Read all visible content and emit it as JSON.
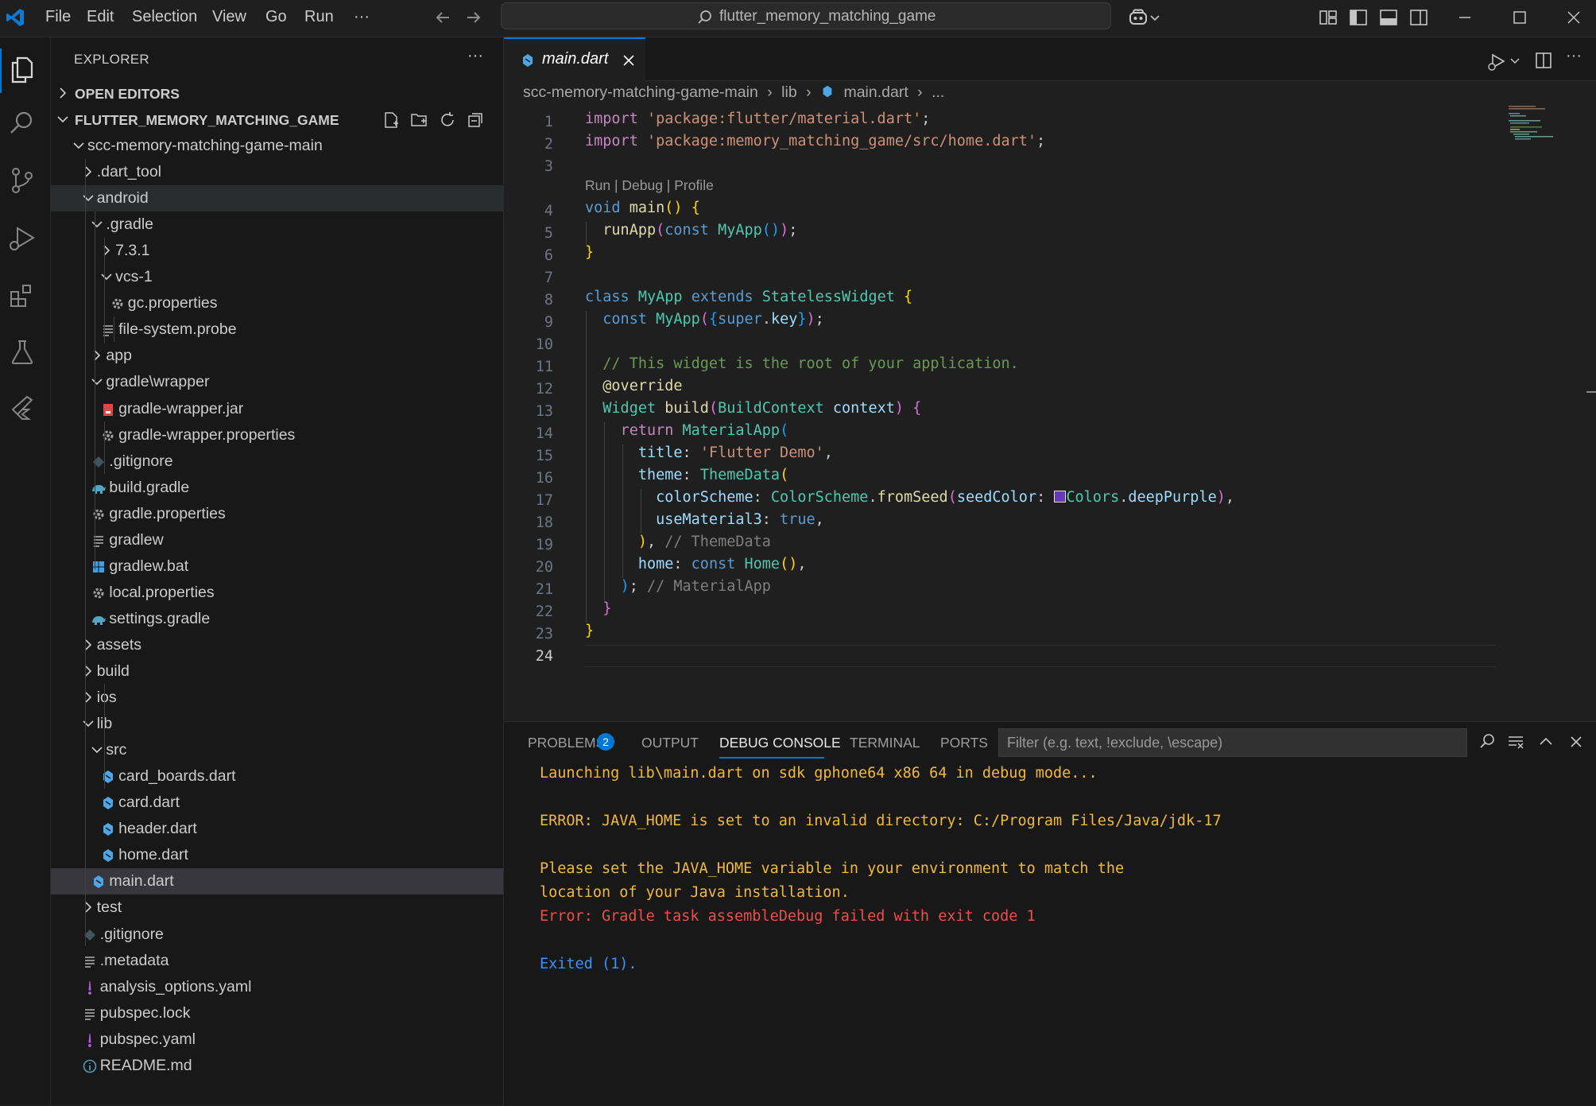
{
  "titlebar": {
    "menu": [
      "File",
      "Edit",
      "Selection",
      "View",
      "Go",
      "Run",
      "···"
    ],
    "search_text": "flutter_memory_matching_game"
  },
  "sidebar": {
    "title": "EXPLORER",
    "open_editors": "OPEN EDITORS",
    "root": "FLUTTER_MEMORY_MATCHING_GAME",
    "tree": [
      {
        "label": "scc-memory-matching-game-main",
        "depth": 0,
        "kind": "folder-open"
      },
      {
        "label": ".dart_tool",
        "depth": 1,
        "kind": "folder"
      },
      {
        "label": "android",
        "depth": 1,
        "kind": "folder-open",
        "highlight": true
      },
      {
        "label": ".gradle",
        "depth": 2,
        "kind": "folder-open"
      },
      {
        "label": "7.3.1",
        "depth": 3,
        "kind": "folder"
      },
      {
        "label": "vcs-1",
        "depth": 3,
        "kind": "folder-open"
      },
      {
        "label": "gc.properties",
        "depth": 4,
        "kind": "gear"
      },
      {
        "label": "file-system.probe",
        "depth": 3,
        "kind": "lines"
      },
      {
        "label": "app",
        "depth": 2,
        "kind": "folder"
      },
      {
        "label": "gradle\\wrapper",
        "depth": 2,
        "kind": "folder-open"
      },
      {
        "label": "gradle-wrapper.jar",
        "depth": 3,
        "kind": "jar"
      },
      {
        "label": "gradle-wrapper.properties",
        "depth": 3,
        "kind": "gear"
      },
      {
        "label": ".gitignore",
        "depth": 2,
        "kind": "git"
      },
      {
        "label": "build.gradle",
        "depth": 2,
        "kind": "gradle"
      },
      {
        "label": "gradle.properties",
        "depth": 2,
        "kind": "gear"
      },
      {
        "label": "gradlew",
        "depth": 2,
        "kind": "lines"
      },
      {
        "label": "gradlew.bat",
        "depth": 2,
        "kind": "windows"
      },
      {
        "label": "local.properties",
        "depth": 2,
        "kind": "gear"
      },
      {
        "label": "settings.gradle",
        "depth": 2,
        "kind": "gradle"
      },
      {
        "label": "assets",
        "depth": 1,
        "kind": "folder"
      },
      {
        "label": "build",
        "depth": 1,
        "kind": "folder"
      },
      {
        "label": "ios",
        "depth": 1,
        "kind": "folder"
      },
      {
        "label": "lib",
        "depth": 1,
        "kind": "folder-open"
      },
      {
        "label": "src",
        "depth": 2,
        "kind": "folder-open"
      },
      {
        "label": "card_boards.dart",
        "depth": 3,
        "kind": "dart"
      },
      {
        "label": "card.dart",
        "depth": 3,
        "kind": "dart"
      },
      {
        "label": "header.dart",
        "depth": 3,
        "kind": "dart"
      },
      {
        "label": "home.dart",
        "depth": 3,
        "kind": "dart"
      },
      {
        "label": "main.dart",
        "depth": 2,
        "kind": "dart",
        "selected": true
      },
      {
        "label": "test",
        "depth": 1,
        "kind": "folder"
      },
      {
        "label": ".gitignore",
        "depth": 1,
        "kind": "git"
      },
      {
        "label": ".metadata",
        "depth": 1,
        "kind": "lines"
      },
      {
        "label": "analysis_options.yaml",
        "depth": 1,
        "kind": "yaml"
      },
      {
        "label": "pubspec.lock",
        "depth": 1,
        "kind": "lines"
      },
      {
        "label": "pubspec.yaml",
        "depth": 1,
        "kind": "yaml"
      },
      {
        "label": "README.md",
        "depth": 1,
        "kind": "info"
      }
    ]
  },
  "editor": {
    "tab_label": "main.dart",
    "breadcrumb": [
      "scc-memory-matching-game-main",
      "lib",
      "main.dart",
      "..."
    ],
    "codelens": "Run | Debug | Profile",
    "line_numbers": [
      "1",
      "2",
      "3",
      "4",
      "5",
      "6",
      "7",
      "8",
      "9",
      "10",
      "11",
      "12",
      "13",
      "14",
      "15",
      "16",
      "17",
      "18",
      "19",
      "20",
      "21",
      "22",
      "23",
      "24"
    ],
    "current_line": "24"
  },
  "panel": {
    "tabs": [
      "PROBLEMS",
      "OUTPUT",
      "DEBUG CONSOLE",
      "TERMINAL",
      "PORTS"
    ],
    "problems_count": "2",
    "filter_placeholder": "Filter (e.g. text, !exclude, \\escape)",
    "console": [
      {
        "text": "Launching lib\\main.dart on sdk gphone64 x86 64 in debug mode...",
        "tone": "warn"
      },
      {
        "text": "ERROR: JAVA_HOME is set to an invalid directory: C:/Program Files/Java/jdk-17",
        "tone": "warn"
      },
      {
        "text": "Please set the JAVA_HOME variable in your environment to match the",
        "tone": "warn"
      },
      {
        "text": "location of your Java installation.",
        "tone": "warn"
      },
      {
        "text": "Error: Gradle task assembleDebug failed with exit code 1",
        "tone": "error"
      },
      {
        "text": "Exited (1).",
        "tone": "info"
      }
    ]
  },
  "colors": {
    "accent": "#0078d4",
    "warn": "#f0b93b",
    "error": "#f14c4c",
    "info": "#3794ff"
  }
}
